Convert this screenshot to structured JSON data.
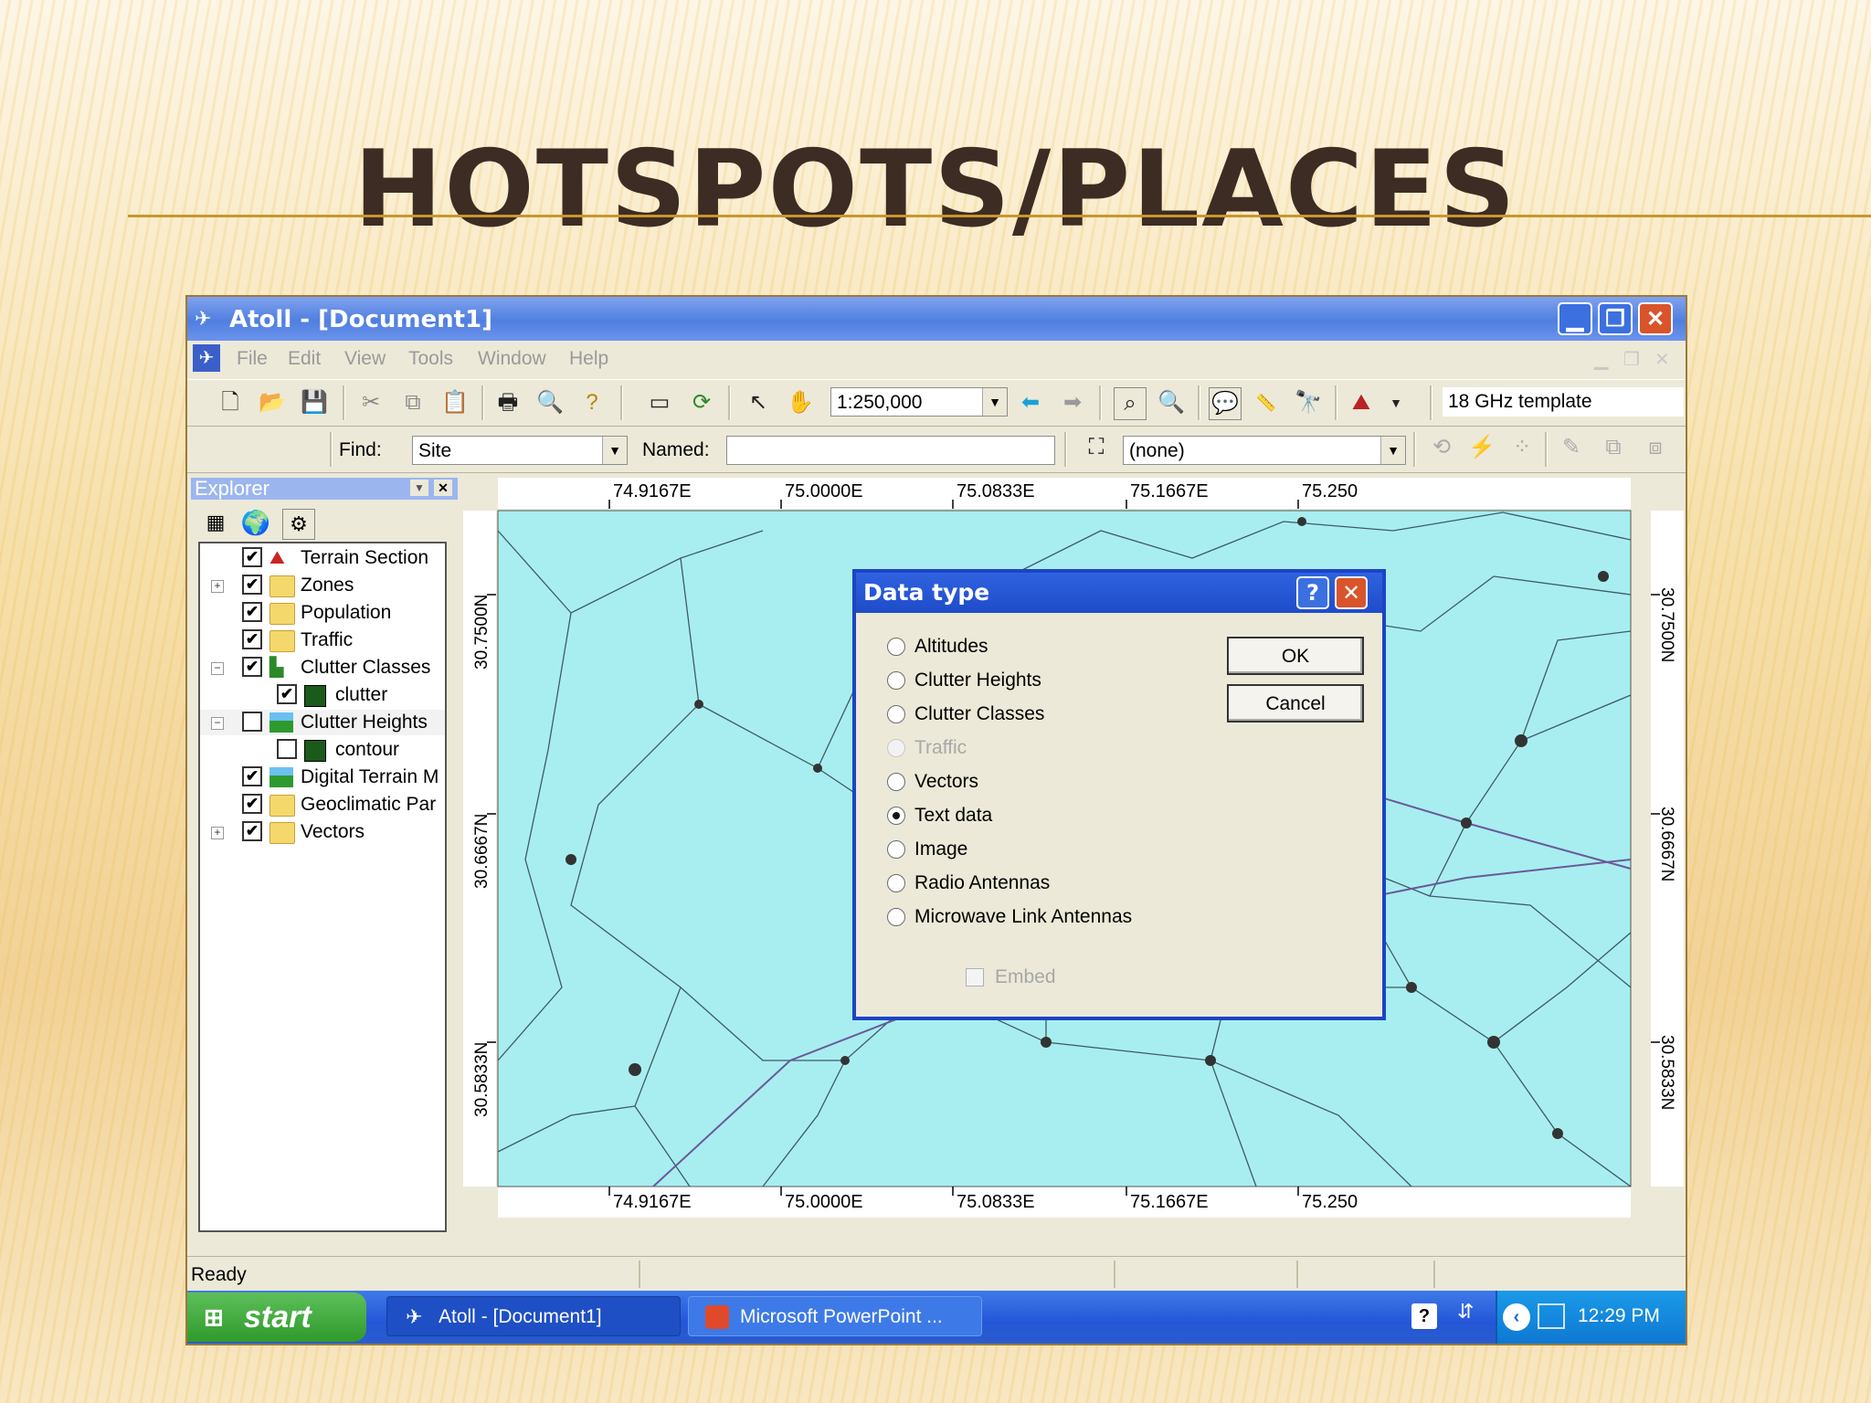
{
  "slide": {
    "title": "HOTSPOTS/PLACES"
  },
  "window": {
    "title": "Atoll - [Document1]",
    "min": "▁",
    "max": "❐",
    "close": "✕"
  },
  "menu": [
    "File",
    "Edit",
    "View",
    "Tools",
    "Window",
    "Help"
  ],
  "toolbar": {
    "scale": "1:250,000",
    "template": "18 GHz template"
  },
  "findbar": {
    "find_label": "Find:",
    "find_value": "Site",
    "named_label": "Named:",
    "named_value": "",
    "filter_value": "(none)"
  },
  "explorer": {
    "title": "Explorer",
    "items": [
      {
        "label": "Terrain Section",
        "checked": "✔"
      },
      {
        "label": "Zones",
        "checked": "✔"
      },
      {
        "label": "Population",
        "checked": "✔"
      },
      {
        "label": "Traffic",
        "checked": "✔"
      },
      {
        "label": "Clutter Classes",
        "checked": "✔"
      },
      {
        "label": "clutter",
        "checked": "✔"
      },
      {
        "label": "Clutter Heights",
        "checked": ""
      },
      {
        "label": "contour",
        "checked": ""
      },
      {
        "label": "Digital Terrain M",
        "checked": "✔"
      },
      {
        "label": "Geoclimatic Par",
        "checked": "✔"
      },
      {
        "label": "Vectors",
        "checked": "✔"
      }
    ]
  },
  "map": {
    "x_ticks": [
      "74.9167E",
      "75.0000E",
      "75.0833E",
      "75.1667E",
      "75.250"
    ],
    "y_ticks": [
      "30.7500N",
      "30.6667N",
      "30.5833N"
    ]
  },
  "dialog": {
    "title": "Data type",
    "options": [
      "Altitudes",
      "Clutter Heights",
      "Clutter Classes",
      "Traffic",
      "Vectors",
      "Text data",
      "Image",
      "Radio Antennas",
      "Microwave Link Antennas"
    ],
    "selected": "Text data",
    "embed_label": "Embed",
    "ok_label": "OK",
    "cancel_label": "Cancel"
  },
  "status": {
    "text": "Ready"
  },
  "taskbar": {
    "start": "start",
    "task1": "Atoll - [Document1]",
    "task2": "Microsoft PowerPoint ...",
    "clock": "12:29 PM"
  },
  "colors": {
    "map_bg": "#a8eef0",
    "titlebar": "#4f7fe0",
    "taskbar": "#2456d8"
  }
}
